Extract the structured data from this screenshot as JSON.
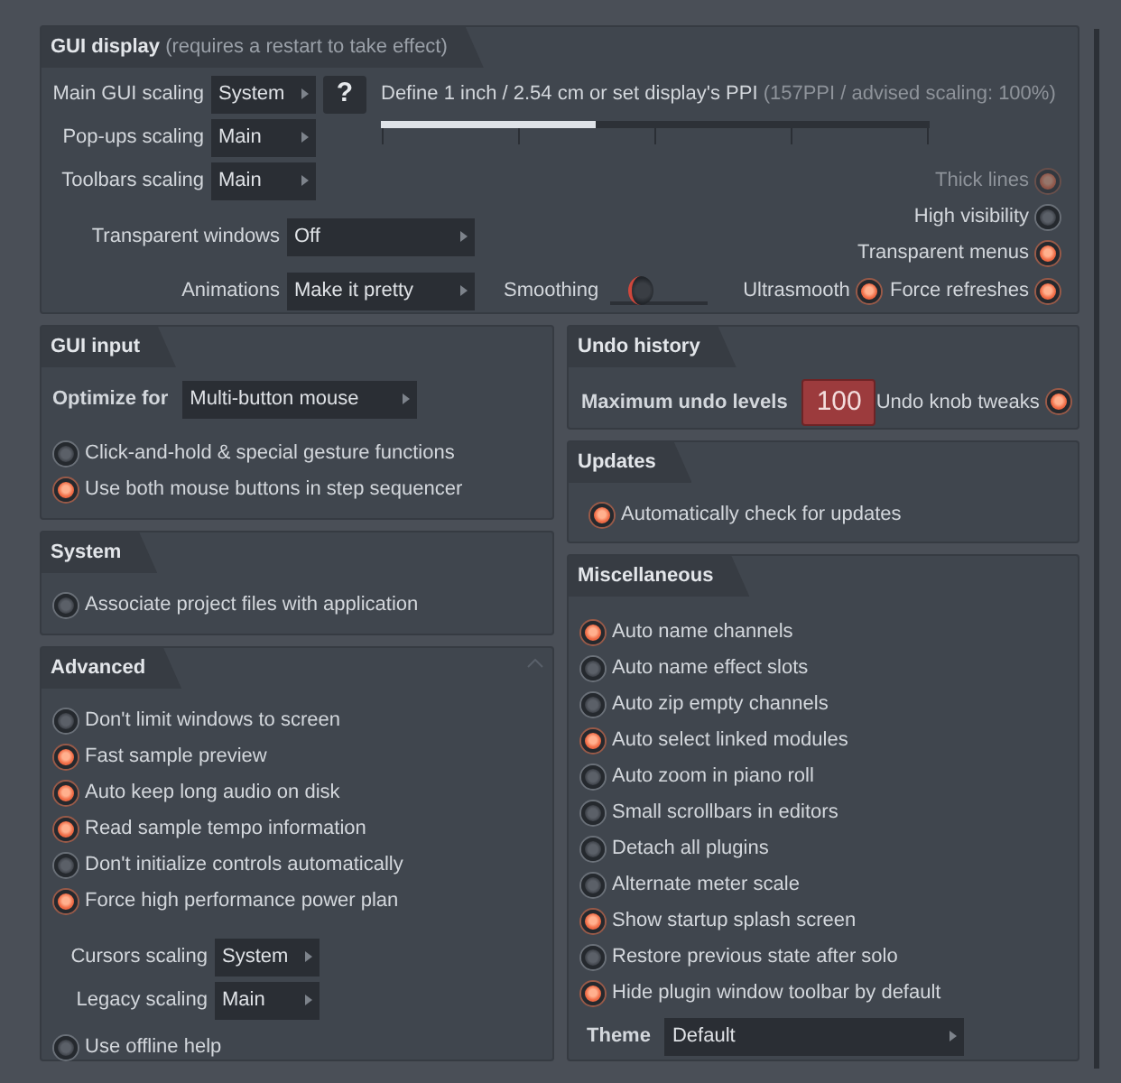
{
  "gui_display": {
    "title": "GUI display",
    "note": "(requires a restart to take effect)",
    "scalings": [
      {
        "label": "Main GUI scaling",
        "value": "System"
      },
      {
        "label": "Pop-ups scaling",
        "value": "Main"
      },
      {
        "label": "Toolbars scaling",
        "value": "Main"
      }
    ],
    "help": "?",
    "ppi": {
      "label": "Define 1 inch / 2.54 cm or set display's PPI",
      "note": "(157PPI / advised scaling: 100%)",
      "level": 0.39
    },
    "transparent_windows": {
      "label": "Transparent windows",
      "value": "Off"
    },
    "animations": {
      "label": "Animations",
      "value": "Make it pretty"
    },
    "smoothing": {
      "label": "Smoothing",
      "level": 0.25
    },
    "toggles": [
      {
        "label": "Thick lines",
        "checked": true,
        "disabled": true
      },
      {
        "label": "High visibility",
        "checked": false,
        "disabled": false
      },
      {
        "label": "Transparent menus",
        "checked": true,
        "disabled": false
      },
      {
        "label": "Ultrasmooth",
        "checked": true,
        "disabled": false
      },
      {
        "label": "Force refreshes",
        "checked": true,
        "disabled": false
      }
    ]
  },
  "gui_input": {
    "title": "GUI input",
    "optimize": {
      "label": "Optimize for",
      "value": "Multi-button mouse"
    },
    "options": [
      {
        "label": "Click-and-hold & special gesture functions",
        "checked": false
      },
      {
        "label": "Use both mouse buttons in step sequencer",
        "checked": true
      }
    ]
  },
  "system": {
    "title": "System",
    "options": [
      {
        "label": "Associate project files with application",
        "checked": false
      }
    ]
  },
  "advanced": {
    "title": "Advanced",
    "options": [
      {
        "label": "Don't limit windows to screen",
        "checked": false
      },
      {
        "label": "Fast sample preview",
        "checked": true
      },
      {
        "label": "Auto keep long audio on disk",
        "checked": true
      },
      {
        "label": "Read sample tempo information",
        "checked": true
      },
      {
        "label": "Don't initialize controls automatically",
        "checked": false
      },
      {
        "label": "Force high performance power plan",
        "checked": true
      }
    ],
    "scalings": [
      {
        "label": "Cursors scaling",
        "value": "System"
      },
      {
        "label": "Legacy scaling",
        "value": "Main"
      }
    ],
    "offline_help": {
      "label": "Use offline help",
      "checked": false
    }
  },
  "undo_history": {
    "title": "Undo history",
    "max_label": "Maximum undo levels",
    "max_value": "100",
    "knob_tweaks": {
      "label": "Undo knob tweaks",
      "checked": true
    }
  },
  "updates": {
    "title": "Updates",
    "options": [
      {
        "label": "Automatically check for updates",
        "checked": true
      }
    ]
  },
  "miscellaneous": {
    "title": "Miscellaneous",
    "options": [
      {
        "label": "Auto name channels",
        "checked": true
      },
      {
        "label": "Auto name effect slots",
        "checked": false
      },
      {
        "label": "Auto zip empty channels",
        "checked": false
      },
      {
        "label": "Auto select linked modules",
        "checked": true
      },
      {
        "label": "Auto zoom in piano roll",
        "checked": false
      },
      {
        "label": "Small scrollbars in editors",
        "checked": false
      },
      {
        "label": "Detach all plugins",
        "checked": false
      },
      {
        "label": "Alternate meter scale",
        "checked": false
      },
      {
        "label": "Show startup splash screen",
        "checked": true
      },
      {
        "label": "Restore previous state after solo",
        "checked": false
      },
      {
        "label": "Hide plugin window toolbar by default",
        "checked": true
      }
    ],
    "theme": {
      "label": "Theme",
      "value": "Default"
    }
  }
}
